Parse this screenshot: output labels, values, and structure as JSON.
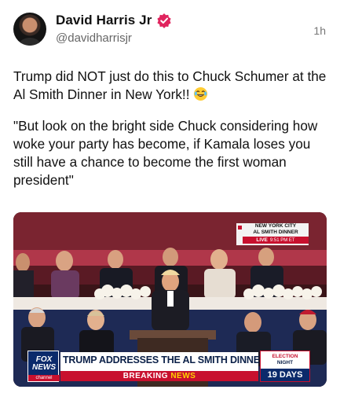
{
  "post": {
    "author": {
      "display_name": "David Harris Jr",
      "handle": "@davidharrisjr",
      "verified": true,
      "badge_color": "#e0245e"
    },
    "timestamp": "1h",
    "body": {
      "paragraph_1": "Trump did NOT just do this to Chuck Schumer at the Al Smith Dinner in New York!!",
      "paragraph_1_emoji": "laughing-face-emoji",
      "paragraph_2": "\"But look on the bright side Chuck considering how woke your party has become, if Kamala loses you still have a chance to become the first woman president\""
    }
  },
  "video": {
    "location_line_1": "NEW YORK CITY",
    "location_line_2": "AL SMITH DINNER",
    "live_label": "LIVE",
    "live_time": "9:51 PM ET",
    "network_logo_line_1": "FOX",
    "network_logo_line_2": "NEWS",
    "network_logo_line_3": "channel",
    "headline": "TRUMP ADDRESSES THE AL SMITH DINNER",
    "breaking_word_1": "BREAKING",
    "breaking_word_2": "NEWS",
    "election_line_1": "ELECTION",
    "election_line_2": "NIGHT",
    "election_countdown": "19 DAYS",
    "colors": {
      "fox_red": "#c8102e",
      "fox_blue": "#0b2a6b",
      "ticker_yellow": "#ffd200"
    }
  }
}
